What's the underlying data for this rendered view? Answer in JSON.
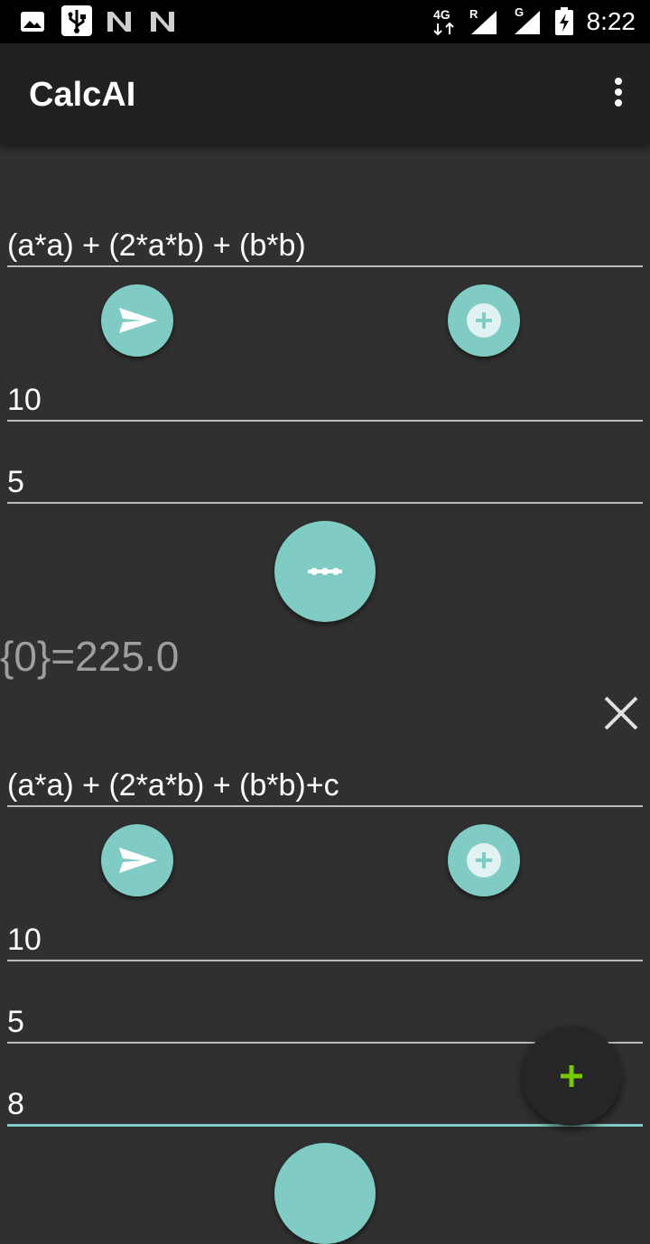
{
  "status_bar": {
    "time": "8:22",
    "network_1": "4G",
    "roaming": "R",
    "network_2": "G",
    "left_icons": [
      "image-icon",
      "usb-icon",
      "n-notification-icon",
      "n-notification-icon"
    ]
  },
  "app_bar": {
    "title": "CalcAI",
    "menu_icon": "more-vert-icon"
  },
  "calc1": {
    "expression": "(a*a) + (2*a*b) + (b*b)",
    "inputs": [
      "10",
      "5"
    ],
    "result": "{0}=225.0"
  },
  "calc2": {
    "expression": "(a*a) + (2*a*b) + (b*b)+c",
    "inputs": [
      "10",
      "5",
      "8"
    ]
  },
  "colors": {
    "accent": "#80cbc4",
    "background": "#303030",
    "toolbar": "#212121",
    "add_fab_plus": "#76c800"
  }
}
